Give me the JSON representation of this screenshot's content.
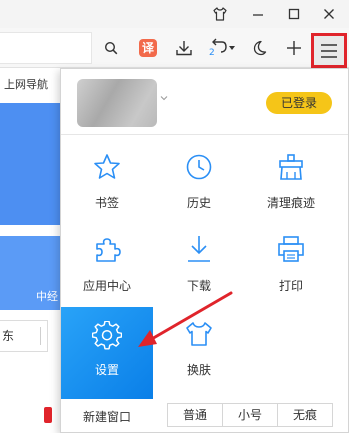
{
  "colors": {
    "accent_red": "#e0242b",
    "active_tile": "#1890f0",
    "badge_yellow": "#f5c518",
    "icon_blue": "#2b8ff5",
    "page_blue": "#4d8ff2"
  },
  "titlebar": {
    "buttons": [
      "shirt-icon",
      "minimize-icon",
      "maximize-icon",
      "close-icon"
    ]
  },
  "toolbar": {
    "icons": [
      "search-icon",
      "translate-icon",
      "download-icon",
      "undo-icon",
      "night-mode-icon",
      "new-tab-icon",
      "menu-icon"
    ],
    "translate_label": "译",
    "undo_count": "2"
  },
  "background_page": {
    "nav_text": "上网导航",
    "section_label": "中经",
    "input_text": "东"
  },
  "menu": {
    "login_badge": "已登录",
    "items": [
      {
        "label": "书签",
        "icon": "star-icon"
      },
      {
        "label": "历史",
        "icon": "clock-icon"
      },
      {
        "label": "清理痕迹",
        "icon": "broom-icon"
      },
      {
        "label": "应用中心",
        "icon": "puzzle-icon"
      },
      {
        "label": "下载",
        "icon": "download-icon"
      },
      {
        "label": "打印",
        "icon": "printer-icon"
      },
      {
        "label": "设置",
        "icon": "gear-icon"
      },
      {
        "label": "换肤",
        "icon": "shirt-icon"
      }
    ],
    "active_item": "设置",
    "new_window_label": "新建窗口",
    "window_modes": [
      "普通",
      "小号",
      "无痕"
    ]
  }
}
